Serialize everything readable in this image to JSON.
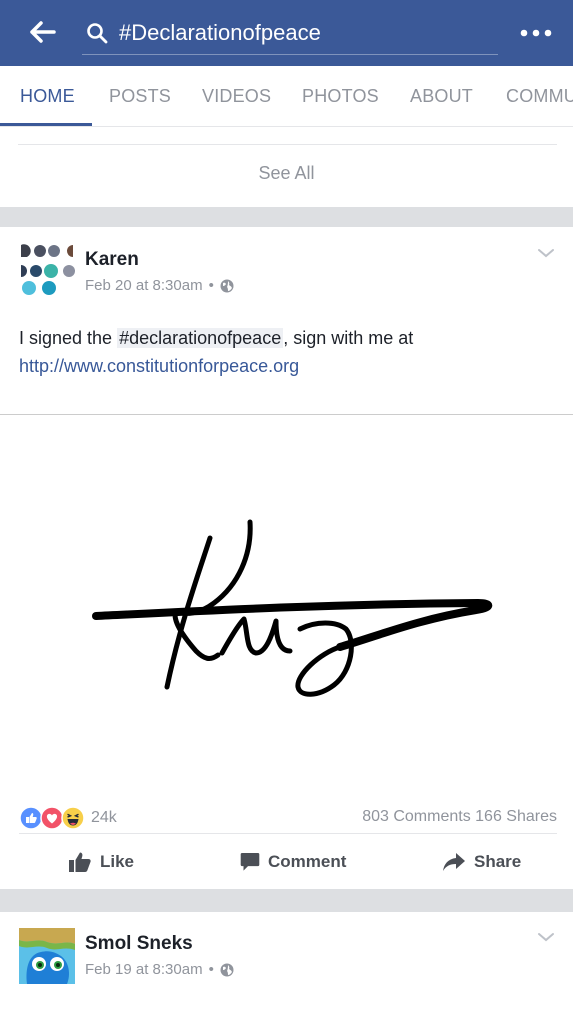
{
  "header": {
    "search_value": "#Declarationofpeace",
    "background": "#3b5998",
    "icons": {
      "back": "back-arrow-icon",
      "search": "search-icon",
      "more": "more-dots-icon"
    }
  },
  "tabs": [
    {
      "label": "HOME",
      "active": true
    },
    {
      "label": "POSTS",
      "active": false
    },
    {
      "label": "VIDEOS",
      "active": false
    },
    {
      "label": "PHOTOS",
      "active": false
    },
    {
      "label": "ABOUT",
      "active": false
    },
    {
      "label": "COMMU",
      "active": false
    }
  ],
  "see_all": "See All",
  "post": {
    "author": "Karen",
    "time": "Feb 20 at 8:30am",
    "separator": "•",
    "audience_icon": "globe-icon",
    "text_before": "I signed the ",
    "hashtag": "#declarationofpeace",
    "text_after": ", sign with me at",
    "link": "http://www.constitutionforpeace.org",
    "reaction_icons": [
      "like-reaction-icon",
      "love-reaction-icon",
      "haha-reaction-icon"
    ],
    "reaction_count": "24k",
    "comments": "803 Comments",
    "shares": "166 Shares",
    "actions": {
      "like": "Like",
      "comment": "Comment",
      "share": "Share"
    }
  },
  "next_post": {
    "author": "Smol Sneks",
    "time": "Feb 19 at 8:30am",
    "separator": "•",
    "audience_icon": "globe-icon"
  },
  "colors": {
    "brand": "#3b5998",
    "link": "#385898",
    "meta": "#90949c",
    "separator": "#dddfe2"
  }
}
